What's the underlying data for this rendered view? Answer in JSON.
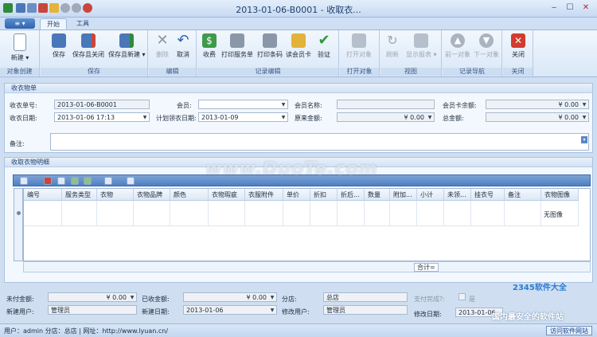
{
  "window": {
    "title": "2013-01-06-B0001 - 收取衣...",
    "controls": [
      "minimize-icon",
      "maximize-icon",
      "close-icon"
    ]
  },
  "tabs": [
    {
      "label": "开始"
    },
    {
      "label": "工具"
    }
  ],
  "app_button": "≡ ▾",
  "ribbon": {
    "groups": [
      {
        "label": "对象创建",
        "buttons": [
          {
            "label": "新建 ▾"
          }
        ]
      },
      {
        "label": "保存",
        "buttons": [
          {
            "label": "保存"
          },
          {
            "label": "保存且关闭"
          },
          {
            "label": "保存且新建 ▾"
          }
        ]
      },
      {
        "label": "编辑",
        "buttons": [
          {
            "label": "删除"
          },
          {
            "label": "取消"
          }
        ]
      },
      {
        "label": "记录编辑",
        "buttons": [
          {
            "label": "收费"
          },
          {
            "label": "打印服务单"
          },
          {
            "label": "打印条码"
          },
          {
            "label": "读会员卡"
          },
          {
            "label": "验证"
          }
        ]
      },
      {
        "label": "打开对象",
        "buttons": [
          {
            "label": "打开对象"
          }
        ]
      },
      {
        "label": "视图",
        "buttons": [
          {
            "label": "刷新"
          },
          {
            "label": "显示报表 ▾"
          }
        ]
      },
      {
        "label": "记录导航",
        "buttons": [
          {
            "label": "前一对象"
          },
          {
            "label": "下一对象"
          }
        ]
      },
      {
        "label": "关闭",
        "buttons": [
          {
            "label": "关闭"
          }
        ]
      }
    ]
  },
  "receipt": {
    "header": "收衣物单",
    "order_no_label": "收衣单号:",
    "order_no": "2013-01-06-B0001",
    "member_label": "会员:",
    "member": "",
    "member_name_label": "会员名称:",
    "member_name": "",
    "card_balance_label": "会员卡余额:",
    "card_balance": "¥ 0.00",
    "date_label": "收衣日期:",
    "date": "2013-01-06 17:13",
    "pickup_label": "计划领衣日期:",
    "pickup": "2013-01-09",
    "original_label": "原来金额:",
    "original": "¥ 0.00",
    "total_label": "总金额:",
    "total": "¥ 0.00",
    "remark_label": "备注:"
  },
  "details": {
    "header": "收取衣物明细",
    "columns": [
      "编号",
      "服务类型",
      "衣物",
      "衣物品牌",
      "颜色",
      "衣物瑕疵",
      "衣服附件",
      "单价",
      "折扣",
      "折后...",
      "数量",
      "附加...",
      "小计",
      "未领...",
      "挂衣号",
      "备注",
      "衣物图像"
    ],
    "image_cell": "无图像",
    "sum_label": "合计="
  },
  "footer": {
    "unpaid_label": "未付金额:",
    "unpaid": "¥ 0.00",
    "paid_label": "已收金额:",
    "paid": "¥ 0.00",
    "branch_label": "分店:",
    "branch": "总店",
    "pay_done_label": "支付完成?:",
    "pay_done": "是",
    "creator_label": "新建用户:",
    "creator": "管理员",
    "created_label": "新建日期:",
    "created": "2013-01-06",
    "modifier_label": "修改用户:",
    "modifier": "管理员",
    "modified_label": "修改日期:",
    "modified": "2013-01-06"
  },
  "status": {
    "text": "用户：admin  分店：总店 | 网址：http://www.lyuan.cn/",
    "link": "访问软件网站"
  },
  "watermarks": {
    "duote": "www.DuoTe.com",
    "s2345": "2345软件大全",
    "s2345_sub": "国内最安全的软件站"
  }
}
